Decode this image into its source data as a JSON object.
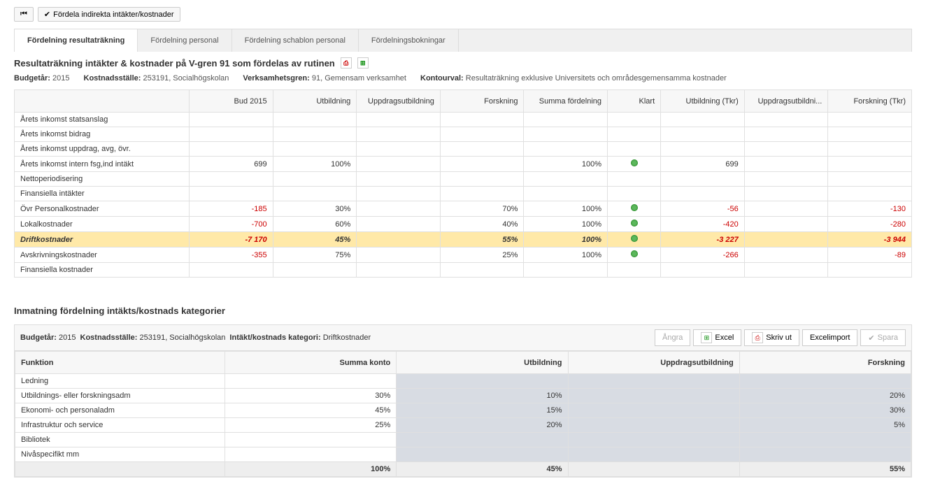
{
  "toolbar": {
    "back_icon": "⏮",
    "distribute_label": "Fördela indirekta intäkter/kostnader",
    "check_icon": "✔"
  },
  "tabs": [
    "Fördelning resultaträkning",
    "Fördelning personal",
    "Fördelning schablon personal",
    "Fördelningsbokningar"
  ],
  "section1": {
    "title": "Resultaträkning intäkter & kostnader på V-gren 91 som fördelas av rutinen",
    "meta": {
      "budget_year_label": "Budgetår:",
      "budget_year": "2015",
      "cost_center_label": "Kostnadsställe:",
      "cost_center": "253191, Socialhögskolan",
      "branch_label": "Verksamhetsgren:",
      "branch": "91, Gemensam verksamhet",
      "kontour_label": "Kontourval:",
      "kontour": "Resultaträkning exklusive Universitets och områdesgemensamma kostnader"
    },
    "columns": [
      "",
      "Bud 2015",
      "Utbildning",
      "Uppdragsutbildning",
      "Forskning",
      "Summa fördelning",
      "Klart",
      "Utbildning (Tkr)",
      "Uppdragsutbildni...",
      "Forskning (Tkr)"
    ],
    "rows": [
      {
        "name": "Årets inkomst statsanslag"
      },
      {
        "name": "Årets inkomst bidrag"
      },
      {
        "name": "Årets inkomst uppdrag, avg, övr."
      },
      {
        "name": "Årets inkomst intern fsg,ind intäkt",
        "bud": "699",
        "utb": "100%",
        "summa": "100%",
        "klart": true,
        "utb_tkr": "699"
      },
      {
        "name": "Nettoperiodisering"
      },
      {
        "name": "Finansiella intäkter"
      },
      {
        "name": "Övr Personalkostnader",
        "bud": "-185",
        "bud_neg": true,
        "utb": "30%",
        "forsk": "70%",
        "summa": "100%",
        "klart": true,
        "utb_tkr": "-56",
        "utb_tkr_neg": true,
        "forsk_tkr": "-130",
        "forsk_tkr_neg": true
      },
      {
        "name": "Lokalkostnader",
        "bud": "-700",
        "bud_neg": true,
        "utb": "60%",
        "forsk": "40%",
        "summa": "100%",
        "klart": true,
        "utb_tkr": "-420",
        "utb_tkr_neg": true,
        "forsk_tkr": "-280",
        "forsk_tkr_neg": true
      },
      {
        "name": "Driftkostnader",
        "bud": "-7 170",
        "bud_neg": true,
        "utb": "45%",
        "forsk": "55%",
        "summa": "100%",
        "klart": true,
        "utb_tkr": "-3 227",
        "utb_tkr_neg": true,
        "forsk_tkr": "-3 944",
        "forsk_tkr_neg": true,
        "highlight": true
      },
      {
        "name": "Avskrivningskostnader",
        "bud": "-355",
        "bud_neg": true,
        "utb": "75%",
        "forsk": "25%",
        "summa": "100%",
        "klart": true,
        "utb_tkr": "-266",
        "utb_tkr_neg": true,
        "forsk_tkr": "-89",
        "forsk_tkr_neg": true
      },
      {
        "name": "Finansiella kostnader"
      }
    ]
  },
  "section2": {
    "title": "Inmatning fördelning intäkts/kostnads kategorier",
    "header": {
      "budget_year_label": "Budgetår:",
      "budget_year": "2015",
      "cost_center_label": "Kostnadsställe:",
      "cost_center": "253191, Socialhögskolan",
      "category_label": "Intäkt/kostnads kategori:",
      "category": "Driftkostnader"
    },
    "buttons": {
      "undo": "Ångra",
      "excel": "Excel",
      "print": "Skriv ut",
      "excelimport": "Excelimport",
      "save": "Spara"
    },
    "columns": [
      "Funktion",
      "Summa konto",
      "Utbildning",
      "Uppdragsutbildning",
      "Forskning"
    ],
    "rows": [
      {
        "name": "Ledning"
      },
      {
        "name": "Utbildnings- eller forskningsadm",
        "summa": "30%",
        "utb": "10%",
        "forsk": "20%"
      },
      {
        "name": "Ekonomi- och personaladm",
        "summa": "45%",
        "utb": "15%",
        "forsk": "30%"
      },
      {
        "name": "Infrastruktur och service",
        "summa": "25%",
        "utb": "20%",
        "forsk": "5%"
      },
      {
        "name": "Bibliotek"
      },
      {
        "name": "Nivåspecifikt mm"
      }
    ],
    "footer": {
      "summa": "100%",
      "utb": "45%",
      "uppd": "",
      "forsk": "55%"
    }
  }
}
